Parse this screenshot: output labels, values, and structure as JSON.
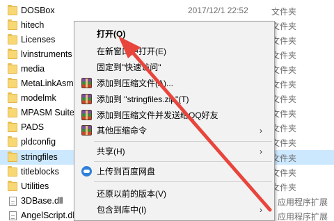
{
  "files": [
    {
      "name": "DOSBox",
      "date": "2017/12/1 22:52",
      "type": "文件夹",
      "icon": "folder-icon"
    },
    {
      "name": "hitech",
      "date": "",
      "type": "文件夹",
      "icon": "folder-icon"
    },
    {
      "name": "Licenses",
      "date": "",
      "type": "文件夹",
      "icon": "folder-icon"
    },
    {
      "name": "lvinstruments",
      "date": "",
      "type": "文件夹",
      "icon": "folder-icon"
    },
    {
      "name": "media",
      "date": "",
      "type": "文件夹",
      "icon": "folder-icon"
    },
    {
      "name": "MetaLinkAsm",
      "date": "",
      "type": "文件夹",
      "icon": "folder-icon"
    },
    {
      "name": "modelmk",
      "date": "",
      "type": "文件夹",
      "icon": "folder-icon"
    },
    {
      "name": "MPASM Suite",
      "date": "",
      "type": "文件夹",
      "icon": "folder-icon"
    },
    {
      "name": "PADS",
      "date": "",
      "type": "文件夹",
      "icon": "folder-icon"
    },
    {
      "name": "pldconfig",
      "date": "",
      "type": "文件夹",
      "icon": "folder-icon"
    },
    {
      "name": "stringfiles",
      "date": "",
      "type": "文件夹",
      "icon": "folder-icon",
      "selected": true
    },
    {
      "name": "titleblocks",
      "date": "",
      "type": "文件夹",
      "icon": "folder-icon"
    },
    {
      "name": "Utilities",
      "date": "",
      "type": "文件夹",
      "icon": "folder-icon"
    },
    {
      "name": "3DBase.dll",
      "date": "",
      "type": "应用程序扩展",
      "icon": "dll-file-icon"
    },
    {
      "name": "AngelScript.dll",
      "date": "",
      "type": "应用程序扩展",
      "icon": "dll-file-icon"
    }
  ],
  "context_menu": {
    "items": [
      {
        "label": "打开(O)",
        "bold": true,
        "icon": "",
        "submenu": false
      },
      {
        "label": "在新窗口中打开(E)",
        "bold": false,
        "icon": "",
        "submenu": false
      },
      {
        "label": "固定到\"快速访问\"",
        "bold": false,
        "icon": "",
        "submenu": false
      },
      {
        "label": "添加到压缩文件(A)...",
        "bold": false,
        "icon": "winrar-icon",
        "submenu": false
      },
      {
        "label": "添加到 \"stringfiles.zip\"(T)",
        "bold": false,
        "icon": "winrar-icon",
        "submenu": false
      },
      {
        "label": "添加到压缩文件并发送给QQ好友",
        "bold": false,
        "icon": "winrar-icon",
        "submenu": false
      },
      {
        "label": "其他压缩命令",
        "bold": false,
        "icon": "winrar-icon",
        "submenu": true
      },
      {
        "label": "共享(H)",
        "bold": false,
        "icon": "",
        "submenu": true
      },
      {
        "label": "上传到百度网盘",
        "bold": false,
        "icon": "baidu-netdisk-icon",
        "submenu": false
      },
      {
        "label": "还原以前的版本(V)",
        "bold": false,
        "icon": "",
        "submenu": false
      },
      {
        "label": "包含到库中(I)",
        "bold": false,
        "icon": "",
        "submenu": true
      }
    ],
    "submenu_arrow": "›"
  },
  "colors": {
    "selection": "#cce8ff",
    "arrow": "#e8453c",
    "menu_background": "#f2f2f2"
  }
}
